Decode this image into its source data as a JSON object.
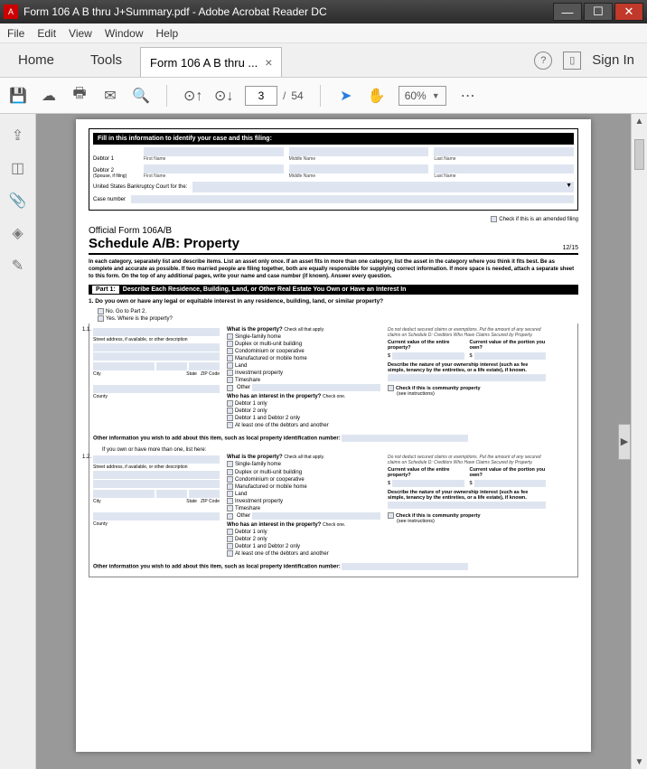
{
  "window": {
    "title": "Form 106 A B thru J+Summary.pdf - Adobe Acrobat Reader DC"
  },
  "menu": {
    "file": "File",
    "edit": "Edit",
    "view": "View",
    "window": "Window",
    "help": "Help"
  },
  "tabs": {
    "home": "Home",
    "tools": "Tools",
    "doc": "Form 106 A B thru ...",
    "signin": "Sign In"
  },
  "toolbar": {
    "page_current": "3",
    "page_sep": "/",
    "page_total": "54",
    "zoom": "60%"
  },
  "form": {
    "fillhdr": "Fill in this information to identify your case and this filing:",
    "debtor1": "Debtor 1",
    "debtor2": "Debtor 2",
    "spouse": "(Spouse, if filing)",
    "first": "First Name",
    "middle": "Middle Name",
    "last": "Last Name",
    "court": "United States Bankruptcy Court for the:",
    "caseno": "Case number",
    "amended": "Check if this is an amended filing",
    "official": "Official Form 106A/B",
    "schedule": "Schedule A/B: Property",
    "date": "12/15",
    "intro": "In each category, separately list and describe items. List an asset only once. If an asset fits in more than one category, list the asset in the category where you think it fits best. Be as complete and accurate as possible. If two married people are filing together, both are equally responsible for supplying correct information. If more space is needed, attach a separate sheet to this form. On the top of any additional pages, write your name and case number (if known). Answer every question.",
    "part1label": "Part 1:",
    "part1text": "Describe Each Residence, Building, Land, or Other Real Estate You Own or Have an Interest In",
    "q1": "1.  Do you own or have any legal or equitable interest in any residence, building, land, or similar property?",
    "no": "No. Go to Part 2.",
    "yes": "Yes. Where is the property?",
    "n11": "1.1.",
    "n12": "1.2.",
    "addrdesc": "Street address, if available, or other description",
    "city": "City",
    "state": "State",
    "zip": "ZIP Code",
    "county": "County",
    "whatprop": "What is the property?",
    "checkall": "Check all that apply.",
    "opt_sfh": "Single-family home",
    "opt_duplex": "Duplex or multi-unit building",
    "opt_condo": "Condominium or cooperative",
    "opt_mobile": "Manufactured or mobile home",
    "opt_land": "Land",
    "opt_invest": "Investment property",
    "opt_timeshare": "Timeshare",
    "opt_other": "Other",
    "whoint": "Who has an interest in the property?",
    "checkone": "Check one.",
    "d1only": "Debtor 1 only",
    "d2only": "Debtor 2 only",
    "d12": "Debtor 1 and Debtor 2 only",
    "atleast": "At least one of the debtors and another",
    "note": "Do not deduct secured claims or exemptions. Put the amount of any secured claims on Schedule D: Creditors Who Have Claims Secured by Property.",
    "curval_entire": "Current value of the entire property?",
    "curval_portion": "Current value of the portion you own?",
    "dollar": "$",
    "nature": "Describe the nature of your ownership interest (such as fee simple, tenancy by the entireties, or a life estate), if known.",
    "commprop": "Check if this is community property",
    "seeinst": "(see instructions)",
    "otherinfo": "Other information you wish to add about this item, such as local property identification number:",
    "morethan": "If you own or have more than one, list here:"
  }
}
